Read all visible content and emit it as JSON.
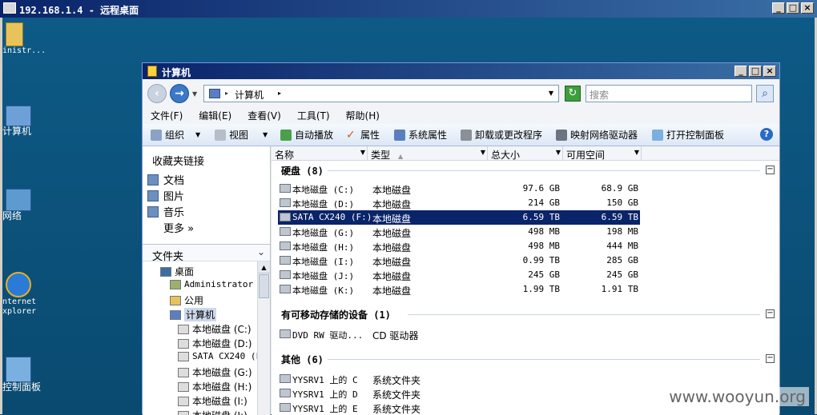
{
  "rdp": {
    "title": "192.168.1.4 - 远程桌面"
  },
  "desktop": {
    "icons": [
      {
        "label": "inistr..."
      },
      {
        "label": "计算机"
      },
      {
        "label": "网络"
      },
      {
        "label": "nternet\nxplorer"
      },
      {
        "label": "控制面板"
      }
    ]
  },
  "explorer": {
    "title": "计算机",
    "address": {
      "crumb": "计算机",
      "search_placeholder": "搜索"
    },
    "menu": [
      "文件(F)",
      "编辑(E)",
      "查看(V)",
      "工具(T)",
      "帮助(H)"
    ],
    "toolbar": {
      "organize": "组织",
      "views": "视图",
      "autoplay": "自动播放",
      "properties": "属性",
      "system_properties": "系统属性",
      "uninstall": "卸载或更改程序",
      "map_drive": "映射网络驱动器",
      "open_control_panel": "打开控制面板"
    },
    "favorites": {
      "heading": "收藏夹链接",
      "items": [
        "文档",
        "图片",
        "音乐",
        "更多 »"
      ]
    },
    "folders": {
      "heading": "文件夹",
      "tree": [
        "桌面",
        "Administrator",
        "公用",
        "计算机",
        "本地磁盘 (C:)",
        "本地磁盘 (D:)",
        "SATA CX240 (F",
        "本地磁盘 (G:)",
        "本地磁盘 (H:)",
        "本地磁盘 (I:)",
        "本地磁盘 (J:)"
      ]
    },
    "columns": {
      "name": "名称",
      "type": "类型",
      "total": "总大小",
      "free": "可用空间"
    },
    "groups": {
      "hdd": {
        "title": "硬盘 (8)",
        "rows": [
          {
            "name": "本地磁盘 (C:)",
            "type": "本地磁盘",
            "total": "97.6 GB",
            "free": "68.9 GB"
          },
          {
            "name": "本地磁盘 (D:)",
            "type": "本地磁盘",
            "total": "214 GB",
            "free": "150 GB"
          },
          {
            "name": "SATA CX240 (F:)",
            "type": "本地磁盘",
            "total": "6.59 TB",
            "free": "6.59 TB"
          },
          {
            "name": "本地磁盘 (G:)",
            "type": "本地磁盘",
            "total": "498 MB",
            "free": "198 MB"
          },
          {
            "name": "本地磁盘 (H:)",
            "type": "本地磁盘",
            "total": "498 MB",
            "free": "444 MB"
          },
          {
            "name": "本地磁盘 (I:)",
            "type": "本地磁盘",
            "total": "0.99 TB",
            "free": "285 GB"
          },
          {
            "name": "本地磁盘 (J:)",
            "type": "本地磁盘",
            "total": "245 GB",
            "free": "245 GB"
          },
          {
            "name": "本地磁盘 (K:)",
            "type": "本地磁盘",
            "total": "1.99 TB",
            "free": "1.91 TB"
          }
        ]
      },
      "removable": {
        "title": "有可移动存储的设备 (1)",
        "rows": [
          {
            "name": "DVD RW 驱动...",
            "type": "CD 驱动器"
          }
        ]
      },
      "other": {
        "title": "其他 (6)",
        "rows": [
          {
            "name": "YYSRV1 上的 C",
            "type": "系统文件夹"
          },
          {
            "name": "YYSRV1 上的 D",
            "type": "系统文件夹"
          },
          {
            "name": "YYSRV1 上的 E",
            "type": "系统文件夹"
          }
        ]
      }
    }
  },
  "watermark": "www.wooyun.org"
}
